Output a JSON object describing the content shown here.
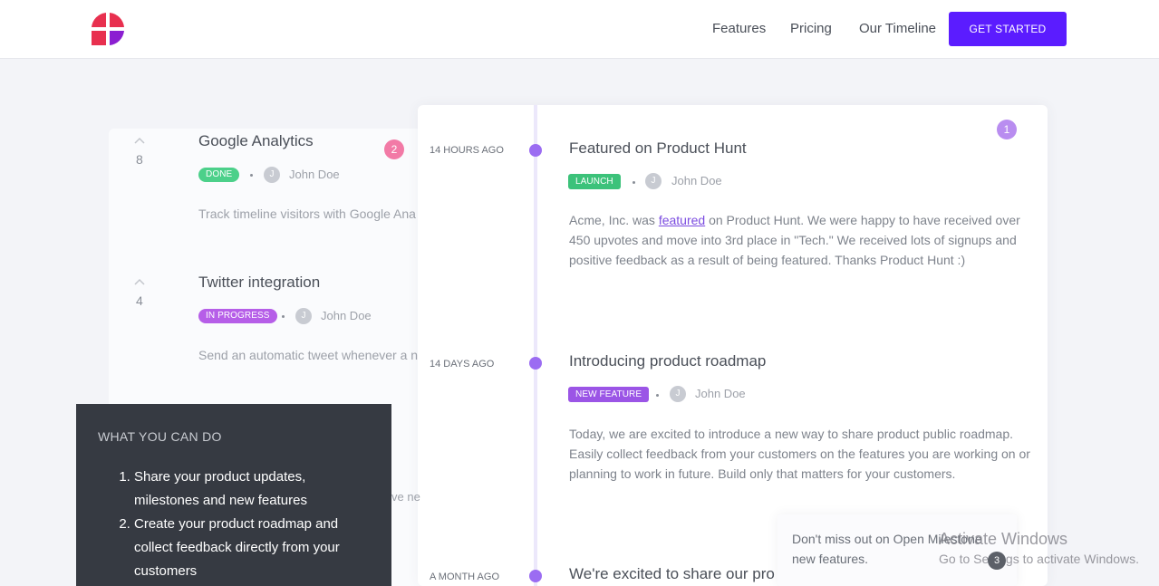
{
  "colors": {
    "brand_primary": "#5b1cff",
    "logo_red": "#e8304f",
    "logo_purple": "#8b1fd1",
    "done_green": "#4cd08a",
    "in_progress_purple": "#b65ee8",
    "launch_green": "#3cc27a",
    "new_feature_purple": "#9b55e6",
    "timeline_dot": "#9b6cf2",
    "badge_pink": "#f27aa6",
    "badge_lavender": "#b98df0",
    "info_panel": "#363a42"
  },
  "nav": {
    "logo_icon": "brand-logo-icon",
    "links": [
      "Features",
      "Pricing",
      "Our Timeline"
    ],
    "cta_label": "GET STARTED"
  },
  "roadmap": {
    "count_badge": "2",
    "items": [
      {
        "votes": "8",
        "title": "Google Analytics",
        "status": "DONE",
        "avatar_initial": "J",
        "author": "John Doe",
        "description": "Track timeline visitors with Google Ana"
      },
      {
        "votes": "4",
        "title": "Twitter integration",
        "status": "IN PROGRESS",
        "avatar_initial": "J",
        "author": "John Doe",
        "description": "Send an automatic tweet whenever a n"
      }
    ],
    "hidden_text": "ve ne"
  },
  "timeline": {
    "count_badge": "1",
    "entries": [
      {
        "time": "14 HOURS AGO",
        "title": "Featured on Product Hunt",
        "tag": "LAUNCH",
        "avatar_initial": "J",
        "author": "John Doe",
        "desc_before": "Acme, Inc. was ",
        "desc_link": "featured",
        "desc_after": " on Product Hunt. We were happy to have received over 450 upvotes and move into 3rd place in \"Tech.\" We received lots of signups and positive feedback as a result of being featured. Thanks Product Hunt :)"
      },
      {
        "time": "14 DAYS AGO",
        "title": "Introducing product roadmap",
        "tag": "NEW FEATURE",
        "avatar_initial": "J",
        "author": "John Doe",
        "description": "Today, we are excited to introduce a new way to share product public roadmap. Easily collect feedback from your customers on the features you are working on or planning to work in future. Build only that matters for your customers."
      },
      {
        "time": "A MONTH AGO",
        "title": "We're excited to share our pro"
      }
    ]
  },
  "info_panel": {
    "heading": "WHAT YOU CAN DO",
    "items": [
      "Share your product updates, milestones and new features",
      "Create your product roadmap and collect feedback directly from your customers"
    ]
  },
  "popup": {
    "text": "Don't miss out on Open Milestone new features."
  },
  "watermark": {
    "title": "Activate Windows",
    "subtitle": "Go to Settings to activate Windows."
  },
  "unread_count": "3"
}
